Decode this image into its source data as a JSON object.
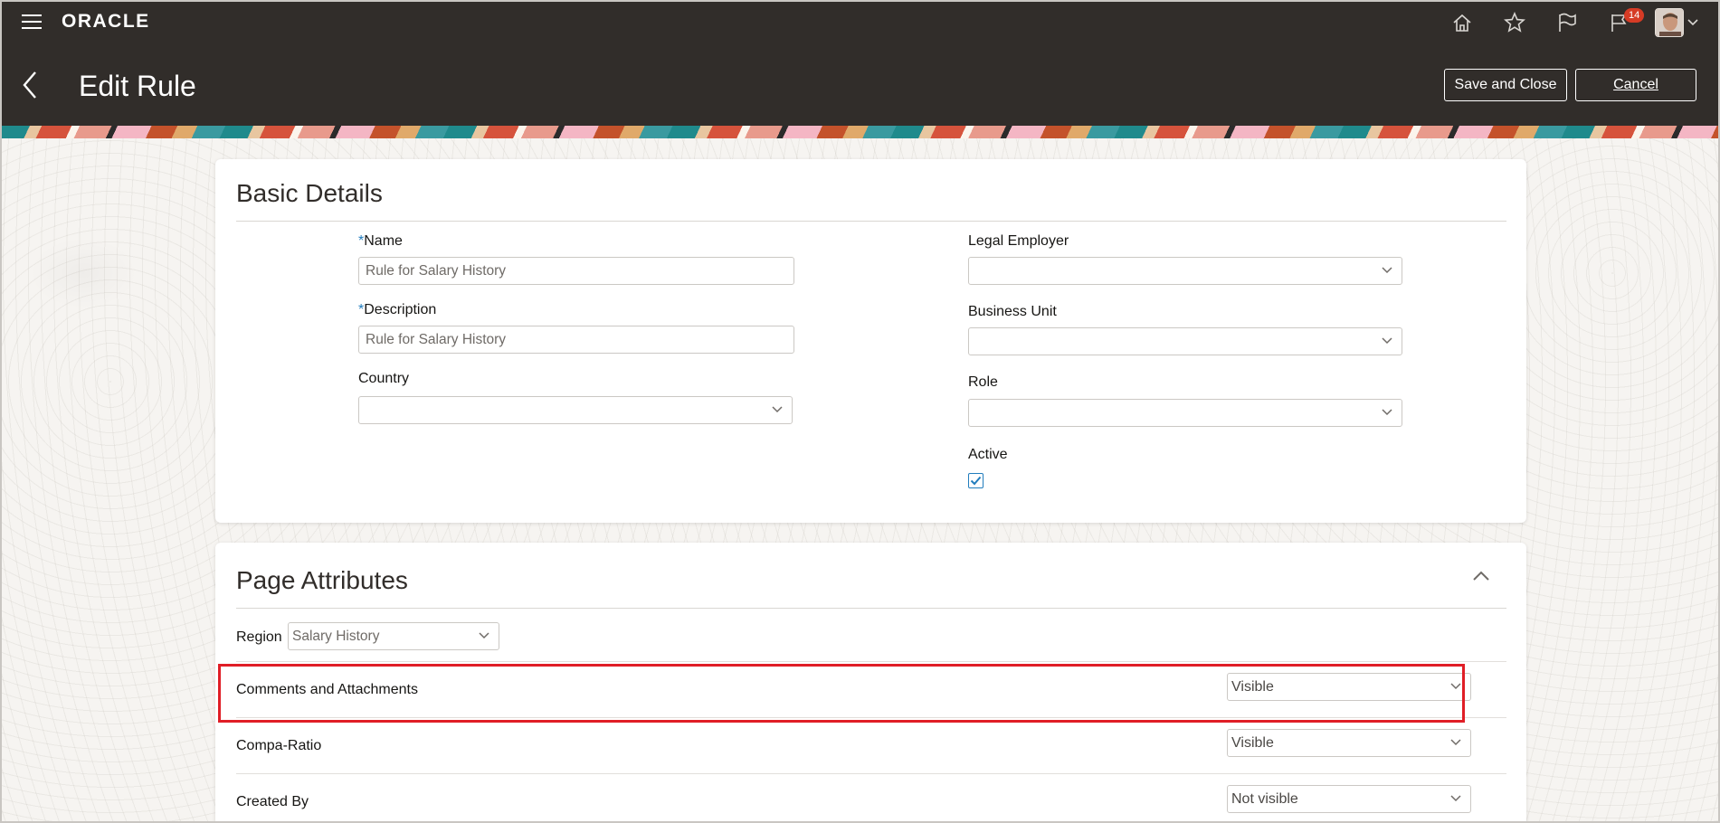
{
  "header": {
    "brand": "ORACLE",
    "page_title": "Edit Rule",
    "notification_count": "14",
    "save_label": "Save and Close",
    "cancel_label": "Cancel"
  },
  "basic_details": {
    "title": "Basic Details",
    "name": {
      "label": "Name",
      "required_mark": "*",
      "value": "Rule for Salary History"
    },
    "description": {
      "label": "Description",
      "required_mark": "*",
      "value": "Rule for Salary History"
    },
    "country": {
      "label": "Country",
      "value": ""
    },
    "legal_employer": {
      "label": "Legal Employer",
      "value": ""
    },
    "business_unit": {
      "label": "Business Unit",
      "value": ""
    },
    "role": {
      "label": "Role",
      "value": ""
    },
    "active": {
      "label": "Active",
      "checked": true
    }
  },
  "page_attributes": {
    "title": "Page Attributes",
    "region": {
      "label": "Region",
      "value": "Salary History"
    },
    "rows": [
      {
        "label": "Comments and Attachments",
        "value": "Visible"
      },
      {
        "label": "Compa-Ratio",
        "value": "Visible"
      },
      {
        "label": "Created By",
        "value": "Not visible"
      }
    ]
  },
  "colors": {
    "header_bg": "#312d2a",
    "accent_blue": "#227dbd",
    "highlight_red": "#e01e26",
    "badge_red": "#d63b25"
  },
  "icons": [
    "menu-icon",
    "home-icon",
    "star-icon",
    "flag-icon",
    "notifications-icon",
    "chevron-left-icon",
    "chevron-down-icon",
    "chevron-up-icon",
    "checkmark-icon"
  ]
}
